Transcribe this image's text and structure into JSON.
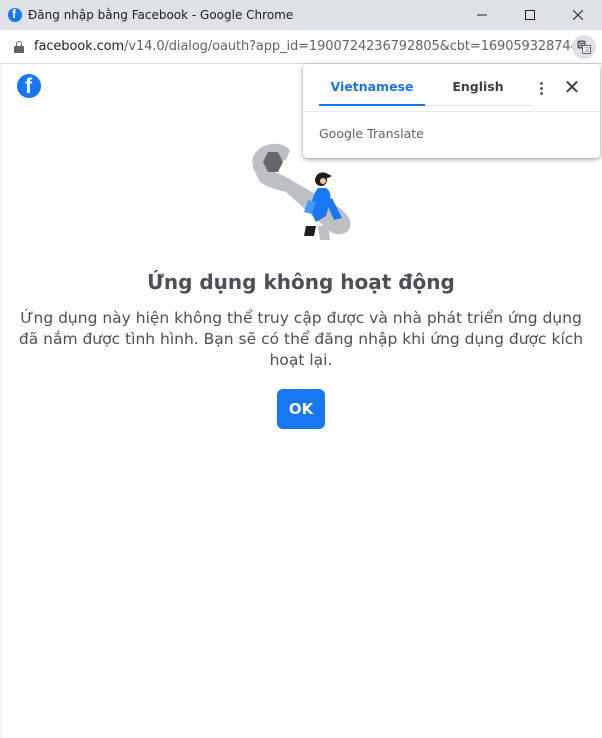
{
  "window": {
    "title": "Đăng nhập bằng Facebook - Google Chrome",
    "minimize_glyph": "—",
    "maximize_glyph": "☐",
    "close_glyph": "✕"
  },
  "address_bar": {
    "host": "facebook.com",
    "path": "/v14.0/dialog/oauth?app_id=1900724236792805&cbt=169059328744..."
  },
  "dialog": {
    "heading": "Ứng dụng không hoạt động",
    "message": "Ứng dụng này hiện không thể truy cập được và nhà phát triển ứng dụng đã nắm được tình hình. Bạn sẽ có thể đăng nhập khi ứng dụng được kích hoạt lại.",
    "ok_label": "OK"
  },
  "translate_popup": {
    "tabs": [
      {
        "label": "Vietnamese",
        "active": true
      },
      {
        "label": "English",
        "active": false
      }
    ],
    "brand_google": "Google",
    "brand_translate": "Translate",
    "close_glyph": "✕"
  },
  "colors": {
    "facebook_blue": "#1877f2",
    "translate_active": "#1a73e8",
    "titlebar_bg": "#dee1e6",
    "text_gray": "#4b4f56"
  },
  "icons": [
    "facebook-favicon-icon",
    "lock-icon",
    "translate-icon",
    "facebook-logo-icon",
    "wrench-illustration",
    "more-vert-icon",
    "close-icon"
  ]
}
